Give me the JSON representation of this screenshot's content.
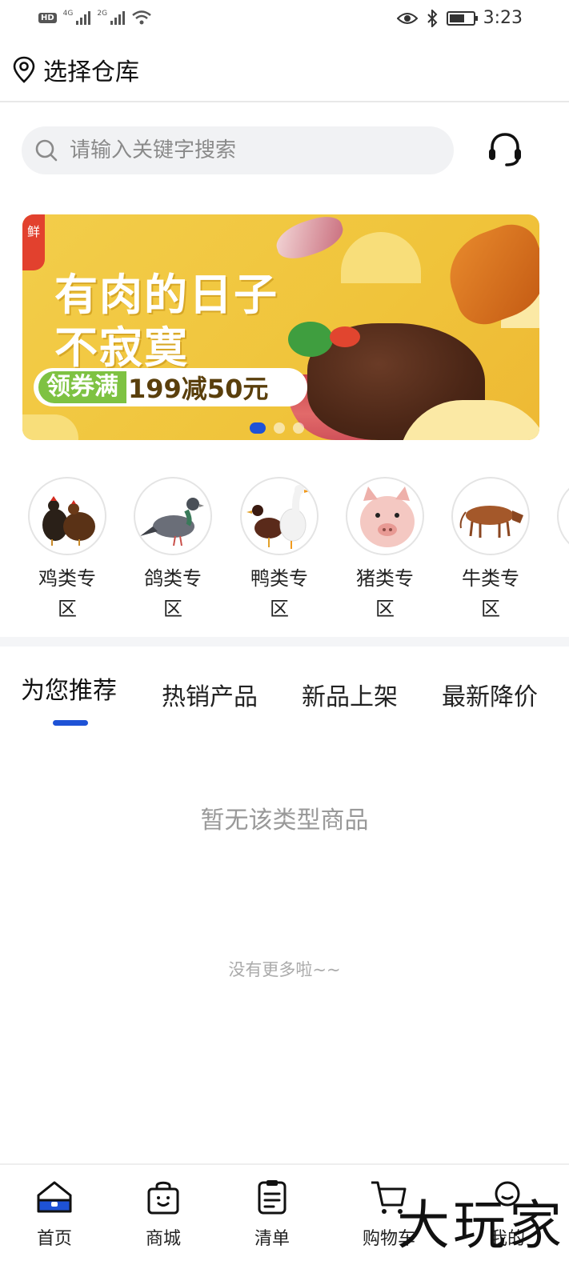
{
  "status_bar": {
    "hd_label": "HD",
    "net1": "4G",
    "net2": "2G",
    "time": "3:23"
  },
  "header": {
    "location_label": "选择仓库"
  },
  "search": {
    "placeholder": "请输入关键字搜索"
  },
  "banner": {
    "title_line1": "有肉的日子",
    "title_line2": "不寂寞",
    "coupon_prefix": "领券满",
    "coupon_amount": "199减50元",
    "corner_text": "鲜",
    "dots_count": 3,
    "active_dot": 0
  },
  "categories": [
    {
      "name": "鸡类专区",
      "icon": "chicken-icon"
    },
    {
      "name": "鸽类专区",
      "icon": "pigeon-icon"
    },
    {
      "name": "鸭类专区",
      "icon": "duck-icon"
    },
    {
      "name": "猪类专区",
      "icon": "pig-icon"
    },
    {
      "name": "牛类专区",
      "icon": "cow-icon"
    }
  ],
  "tabs": [
    {
      "label": "为您推荐",
      "active": true
    },
    {
      "label": "热销产品",
      "active": false
    },
    {
      "label": "新品上架",
      "active": false
    },
    {
      "label": "最新降价",
      "active": false
    }
  ],
  "content": {
    "empty_text": "暂无该类型商品",
    "no_more_text": "没有更多啦~~"
  },
  "bottom_nav": [
    {
      "label": "首页",
      "icon": "home-icon",
      "active": true
    },
    {
      "label": "商城",
      "icon": "shop-bag-icon",
      "active": false
    },
    {
      "label": "清单",
      "icon": "list-icon",
      "active": false
    },
    {
      "label": "购物车",
      "icon": "cart-icon",
      "active": false
    },
    {
      "label": "我的",
      "icon": "profile-icon",
      "active": false
    }
  ],
  "watermark": "大玩家",
  "colors": {
    "accent": "#1e52d6",
    "banner_yellow": "#f0c43b",
    "coupon_green": "#7ec242"
  }
}
